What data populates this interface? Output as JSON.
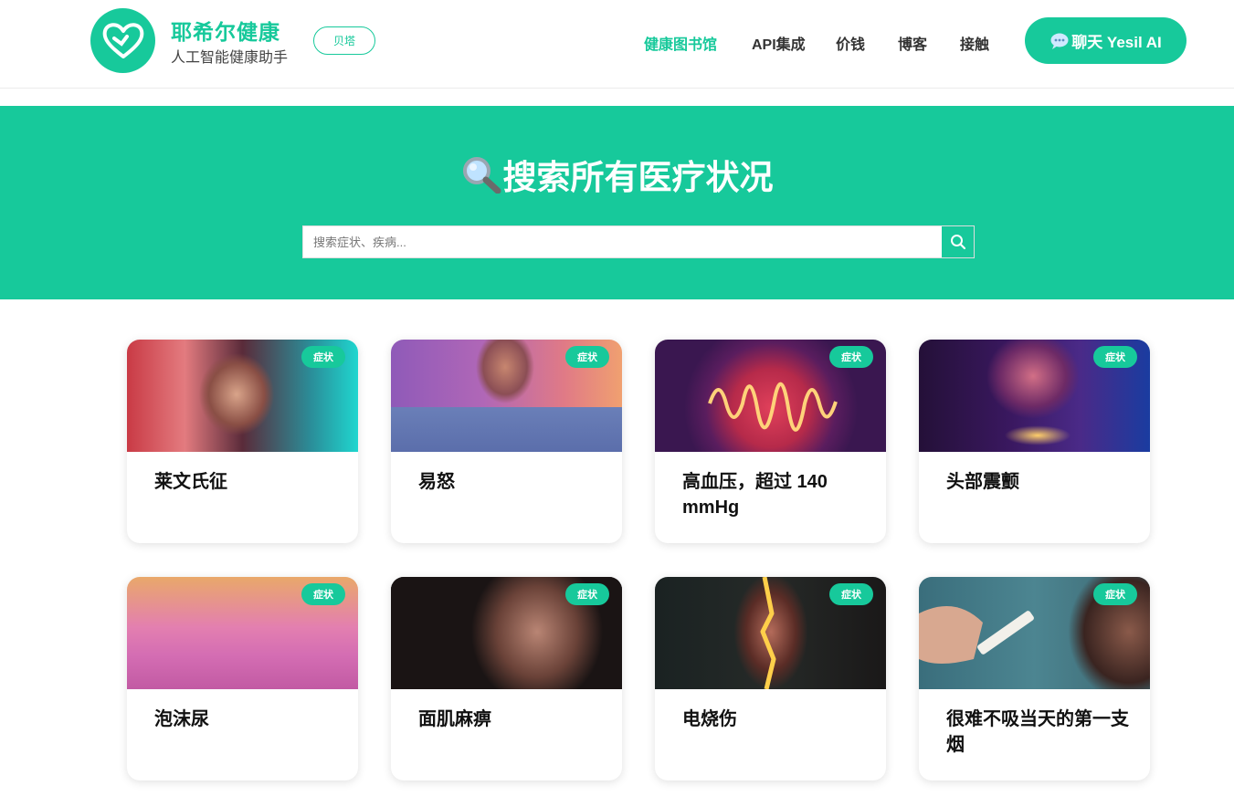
{
  "header": {
    "brand_title": "耶希尔健康",
    "brand_subtitle": "人工智能健康助手",
    "beta_label": "贝塔",
    "nav": [
      {
        "label": "健康图书馆",
        "active": true
      },
      {
        "label": "API集成",
        "active": false
      },
      {
        "label": "价钱",
        "active": false
      },
      {
        "label": "博客",
        "active": false
      },
      {
        "label": "接触",
        "active": false
      }
    ],
    "chat_button": "聊天 Yesil AI",
    "accent_color": "#17c99b"
  },
  "hero": {
    "title": "搜索所有医疗状况",
    "title_icon": "magnifier-icon",
    "search_placeholder": "搜索症状、疾病..."
  },
  "cards": [
    {
      "title": "莱文氏征",
      "tag": "症状",
      "image": "man-red-cyan-portrait"
    },
    {
      "title": "易怒",
      "tag": "症状",
      "image": "man-purple-glow"
    },
    {
      "title": "高血压，超过 140 mmHg",
      "tag": "症状",
      "image": "pressure-wave"
    },
    {
      "title": "头部震颤",
      "tag": "症状",
      "image": "face-blue-neon"
    },
    {
      "title": "泡沫尿",
      "tag": "症状",
      "image": "foam-liquid"
    },
    {
      "title": "面肌麻痹",
      "tag": "症状",
      "image": "face-dark-closeup"
    },
    {
      "title": "电烧伤",
      "tag": "症状",
      "image": "neck-lightning"
    },
    {
      "title": "很难不吸当天的第一支烟",
      "tag": "症状",
      "image": "cigarette-hand"
    }
  ]
}
